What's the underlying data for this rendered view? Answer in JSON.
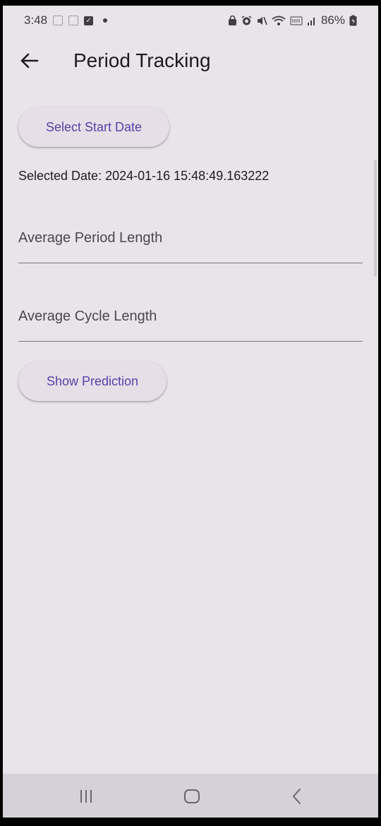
{
  "status_bar": {
    "time": "3:48",
    "battery": "86%"
  },
  "app_bar": {
    "title": "Period Tracking"
  },
  "main": {
    "select_start_label": "Select Start Date",
    "selected_date_text": "Selected Date: 2024-01-16 15:48:49.163222",
    "period_length_placeholder": "Average Period Length",
    "cycle_length_placeholder": "Average Cycle Length",
    "show_prediction_label": "Show Prediction"
  },
  "colors": {
    "background": "#e9e4ea",
    "button_surface": "#e6dfe8",
    "button_text": "#5a3fa6",
    "nav_bar": "#d6d1d8"
  },
  "icons": {
    "back": "arrow-left-icon",
    "nav_recents": "recents-icon",
    "nav_home": "home-icon",
    "nav_back": "chevron-left-icon"
  }
}
